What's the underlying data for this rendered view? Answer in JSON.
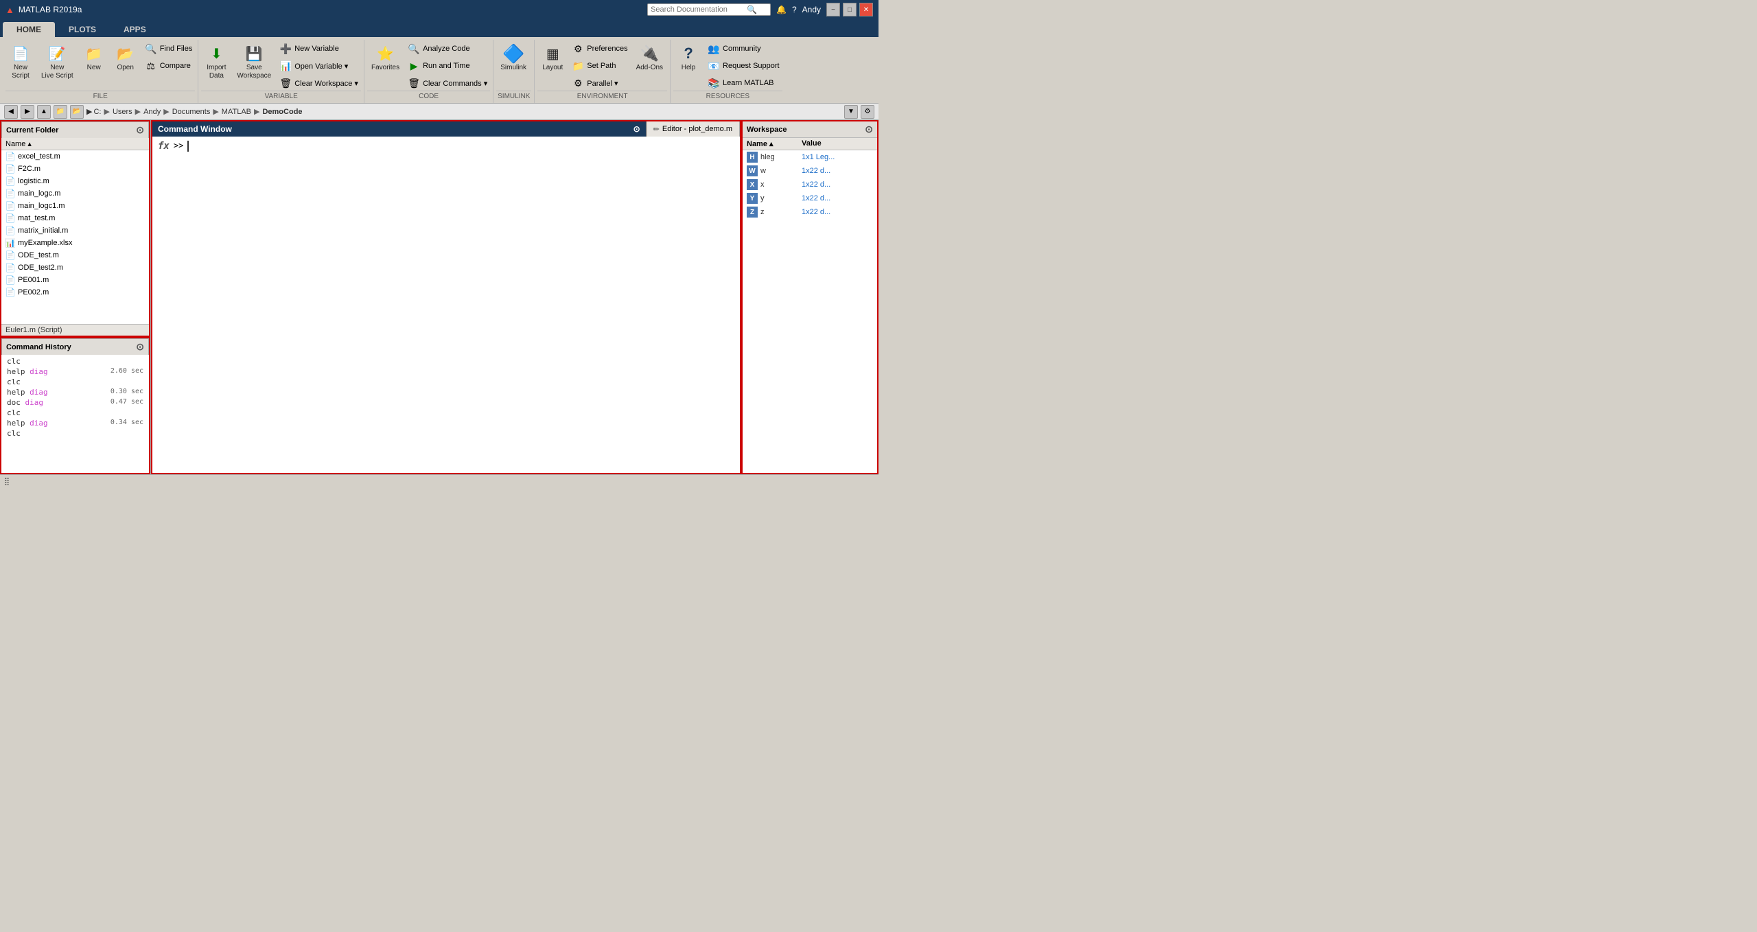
{
  "titlebar": {
    "title": "MATLAB R2019a",
    "logo": "▲",
    "logo_color": "#e74c3c",
    "search_placeholder": "Search Documentation",
    "user": "Andy",
    "minimize": "−",
    "maximize": "□",
    "close": "✕"
  },
  "tabs": [
    {
      "label": "HOME",
      "active": true
    },
    {
      "label": "PLOTS",
      "active": false
    },
    {
      "label": "APPS",
      "active": false
    }
  ],
  "ribbon": {
    "file_group": {
      "label": "FILE",
      "buttons": [
        {
          "label": "New\nScript",
          "icon": "📄"
        },
        {
          "label": "New\nLive Script",
          "icon": "📝"
        },
        {
          "label": "New",
          "icon": "📁"
        },
        {
          "label": "Open",
          "icon": "📂"
        }
      ],
      "small_buttons": [
        {
          "label": "Find Files",
          "icon": "🔍"
        },
        {
          "label": "Compare",
          "icon": "⚖"
        }
      ]
    },
    "variable_group": {
      "label": "VARIABLE",
      "buttons": [
        {
          "label": "Import\nData",
          "icon": "⬇"
        },
        {
          "label": "Save\nWorkspace",
          "icon": "💾"
        }
      ],
      "small_buttons": [
        {
          "label": "New Variable",
          "icon": "➕"
        },
        {
          "label": "Open Variable",
          "icon": "📊"
        },
        {
          "label": "Clear Workspace",
          "icon": "🗑"
        }
      ]
    },
    "code_group": {
      "label": "CODE",
      "buttons": [
        {
          "label": "Favorites",
          "icon": "⭐"
        }
      ],
      "small_buttons": [
        {
          "label": "Analyze Code",
          "icon": "🔍"
        },
        {
          "label": "Run and Time",
          "icon": "▶"
        },
        {
          "label": "Clear Commands",
          "icon": "🗑"
        }
      ]
    },
    "simulink_group": {
      "label": "SIMULINK",
      "buttons": [
        {
          "label": "Simulink",
          "icon": "🔷"
        }
      ]
    },
    "environment_group": {
      "label": "ENVIRONMENT",
      "buttons": [
        {
          "label": "Layout",
          "icon": "▦"
        }
      ],
      "small_buttons": [
        {
          "label": "Preferences",
          "icon": "⚙"
        },
        {
          "label": "Set Path",
          "icon": "📁"
        },
        {
          "label": "Parallel",
          "icon": "⚙"
        },
        {
          "label": "Add-Ons",
          "icon": "🔌"
        }
      ]
    },
    "resources_group": {
      "label": "RESOURCES",
      "buttons": [
        {
          "label": "Help",
          "icon": "?"
        },
        {
          "label": "Add-Ons",
          "icon": "🔌"
        }
      ],
      "small_buttons": [
        {
          "label": "Community",
          "icon": "👥"
        },
        {
          "label": "Request Support",
          "icon": "📧"
        },
        {
          "label": "Learn MATLAB",
          "icon": "📚"
        }
      ]
    }
  },
  "addressbar": {
    "path_parts": [
      "C:",
      "Users",
      "Andy",
      "Documents",
      "MATLAB",
      "DemoCode"
    ]
  },
  "current_folder": {
    "title": "Current Folder",
    "col_label": "Name ▴",
    "files": [
      {
        "name": "excel_test.m",
        "type": "script"
      },
      {
        "name": "F2C.m",
        "type": "script"
      },
      {
        "name": "logistic.m",
        "type": "script"
      },
      {
        "name": "main_logc.m",
        "type": "script"
      },
      {
        "name": "main_logc1.m",
        "type": "script"
      },
      {
        "name": "mat_test.m",
        "type": "script"
      },
      {
        "name": "matrix_initial.m",
        "type": "script"
      },
      {
        "name": "myExample.xlsx",
        "type": "excel"
      },
      {
        "name": "ODE_test.m",
        "type": "script"
      },
      {
        "name": "ODE_test2.m",
        "type": "script"
      },
      {
        "name": "PE001.m",
        "type": "script"
      },
      {
        "name": "PE002.m",
        "type": "script"
      }
    ],
    "preview": "Euler1.m (Script)"
  },
  "command_history": {
    "title": "Command History",
    "items": [
      {
        "cmd": "clc",
        "timing": ""
      },
      {
        "cmd": "help ",
        "highlight": "diag",
        "timing": "2.60 sec"
      },
      {
        "cmd": "clc",
        "timing": ""
      },
      {
        "cmd": "help ",
        "highlight": "diag",
        "timing": "0.30 sec"
      },
      {
        "cmd": "doc ",
        "highlight": "diag",
        "timing": "0.47 sec"
      },
      {
        "cmd": "clc",
        "timing": ""
      },
      {
        "cmd": "help ",
        "highlight": "diag",
        "timing": "0.34 sec"
      },
      {
        "cmd": "clc",
        "timing": ""
      }
    ]
  },
  "command_window": {
    "title": "Command Window",
    "prompt_symbol": "fx",
    "prompt_arrow": ">>"
  },
  "editor_tab": {
    "label": "Editor - plot_demo.m",
    "icon": "✏"
  },
  "workspace": {
    "title": "Workspace",
    "col_name": "Name ▴",
    "col_value": "Value",
    "variables": [
      {
        "name": "hleg",
        "value": "1x1 Leg...",
        "icon": "H"
      },
      {
        "name": "w",
        "value": "1x22 d...",
        "icon": "W"
      },
      {
        "name": "x",
        "value": "1x22 d...",
        "icon": "X"
      },
      {
        "name": "y",
        "value": "1x22 d...",
        "icon": "Y"
      },
      {
        "name": "z",
        "value": "1x22 d...",
        "icon": "Z"
      }
    ]
  },
  "statusbar": {
    "text": ""
  }
}
